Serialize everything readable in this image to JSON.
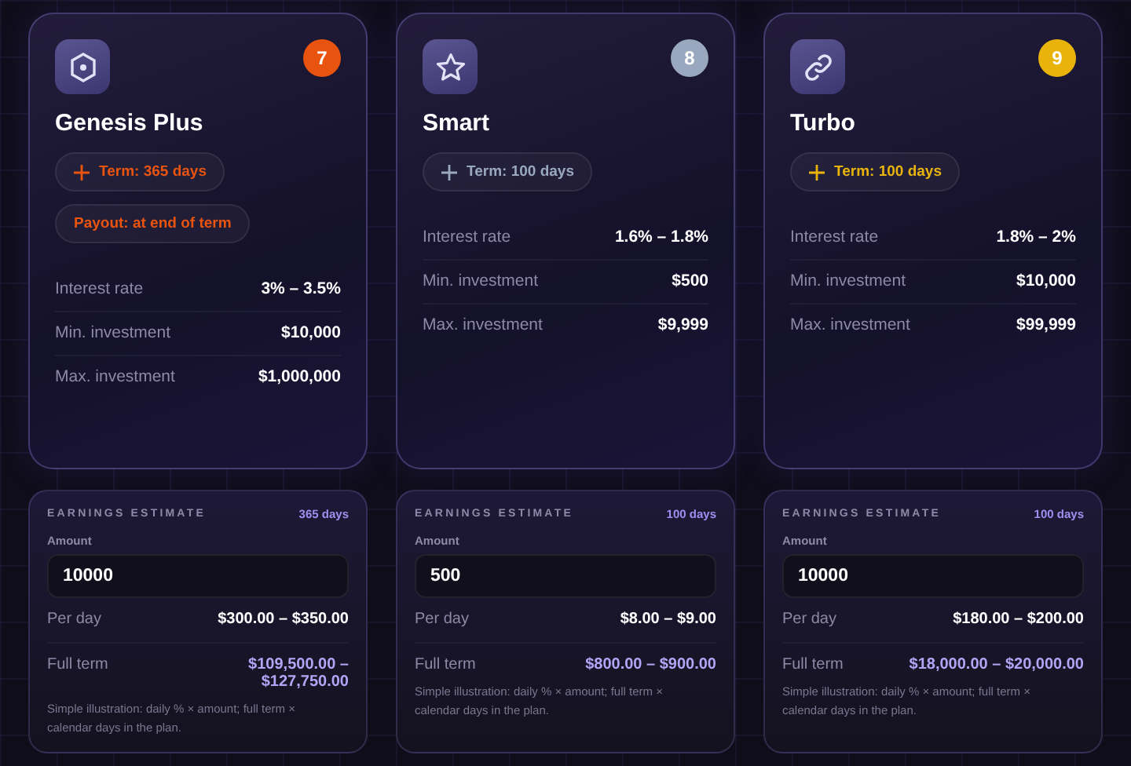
{
  "plans": [
    {
      "kind": "hexagon",
      "badge": "7",
      "color": "#e8540f",
      "name": "Genesis Plus",
      "term": "Term: 365 days",
      "payout": "Payout: at end of term",
      "stats": [
        {
          "label": "Interest rate",
          "value": "3% – 3.5%"
        },
        {
          "label": "Min. investment",
          "value": "$10,000"
        },
        {
          "label": "Max. investment",
          "value": "$1,000,000"
        }
      ],
      "estimate": {
        "title": "EARNINGS ESTIMATE",
        "days": "365 days",
        "amount_label": "Amount",
        "amount": "10000",
        "per_day_label": "Per day",
        "per_day": "$300.00 – $350.00",
        "full_term_label": "Full term",
        "full_term": "$109,500.00 – $127,750.00",
        "note": "Simple illustration: daily % × amount; full term × calendar days in the plan."
      }
    },
    {
      "kind": "star",
      "badge": "8",
      "color": "#9aa8bf",
      "name": "Smart",
      "term": "Term: 100 days",
      "stats": [
        {
          "label": "Interest rate",
          "value": "1.6% – 1.8%"
        },
        {
          "label": "Min. investment",
          "value": "$500"
        },
        {
          "label": "Max. investment",
          "value": "$9,999"
        }
      ],
      "estimate": {
        "title": "EARNINGS ESTIMATE",
        "days": "100 days",
        "amount_label": "Amount",
        "amount": "500",
        "per_day_label": "Per day",
        "per_day": "$8.00 – $9.00",
        "full_term_label": "Full term",
        "full_term": "$800.00 – $900.00",
        "note": "Simple illustration: daily % × amount; full term × calendar days in the plan."
      }
    },
    {
      "kind": "link",
      "badge": "9",
      "color": "#e8b40c",
      "name": "Turbo",
      "term": "Term: 100 days",
      "stats": [
        {
          "label": "Interest rate",
          "value": "1.8% – 2%"
        },
        {
          "label": "Min. investment",
          "value": "$10,000"
        },
        {
          "label": "Max. investment",
          "value": "$99,999"
        }
      ],
      "estimate": {
        "title": "EARNINGS ESTIMATE",
        "days": "100 days",
        "amount_label": "Amount",
        "amount": "10000",
        "per_day_label": "Per day",
        "per_day": "$180.00 – $200.00",
        "full_term_label": "Full term",
        "full_term": "$18,000.00 – $20,000.00",
        "note": "Simple illustration: daily % × amount; full term × calendar days in the plan."
      }
    }
  ]
}
